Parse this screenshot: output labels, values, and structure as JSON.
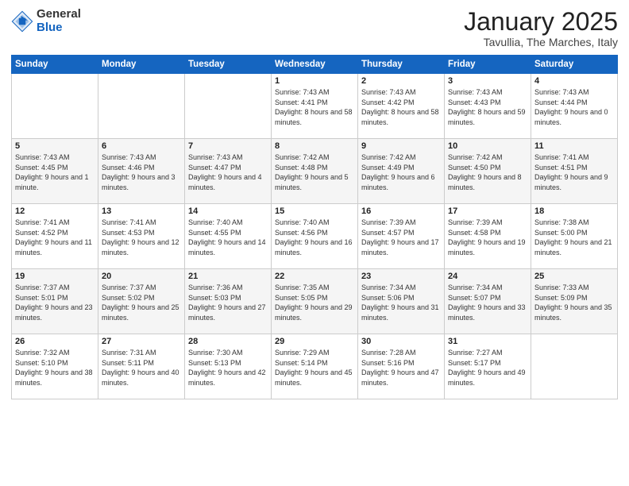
{
  "logo": {
    "general": "General",
    "blue": "Blue"
  },
  "header": {
    "title": "January 2025",
    "subtitle": "Tavullia, The Marches, Italy"
  },
  "weekdays": [
    "Sunday",
    "Monday",
    "Tuesday",
    "Wednesday",
    "Thursday",
    "Friday",
    "Saturday"
  ],
  "weeks": [
    [
      {
        "day": "",
        "info": ""
      },
      {
        "day": "",
        "info": ""
      },
      {
        "day": "",
        "info": ""
      },
      {
        "day": "1",
        "info": "Sunrise: 7:43 AM\nSunset: 4:41 PM\nDaylight: 8 hours\nand 58 minutes."
      },
      {
        "day": "2",
        "info": "Sunrise: 7:43 AM\nSunset: 4:42 PM\nDaylight: 8 hours\nand 58 minutes."
      },
      {
        "day": "3",
        "info": "Sunrise: 7:43 AM\nSunset: 4:43 PM\nDaylight: 8 hours\nand 59 minutes."
      },
      {
        "day": "4",
        "info": "Sunrise: 7:43 AM\nSunset: 4:44 PM\nDaylight: 9 hours\nand 0 minutes."
      }
    ],
    [
      {
        "day": "5",
        "info": "Sunrise: 7:43 AM\nSunset: 4:45 PM\nDaylight: 9 hours\nand 1 minute."
      },
      {
        "day": "6",
        "info": "Sunrise: 7:43 AM\nSunset: 4:46 PM\nDaylight: 9 hours\nand 3 minutes."
      },
      {
        "day": "7",
        "info": "Sunrise: 7:43 AM\nSunset: 4:47 PM\nDaylight: 9 hours\nand 4 minutes."
      },
      {
        "day": "8",
        "info": "Sunrise: 7:42 AM\nSunset: 4:48 PM\nDaylight: 9 hours\nand 5 minutes."
      },
      {
        "day": "9",
        "info": "Sunrise: 7:42 AM\nSunset: 4:49 PM\nDaylight: 9 hours\nand 6 minutes."
      },
      {
        "day": "10",
        "info": "Sunrise: 7:42 AM\nSunset: 4:50 PM\nDaylight: 9 hours\nand 8 minutes."
      },
      {
        "day": "11",
        "info": "Sunrise: 7:41 AM\nSunset: 4:51 PM\nDaylight: 9 hours\nand 9 minutes."
      }
    ],
    [
      {
        "day": "12",
        "info": "Sunrise: 7:41 AM\nSunset: 4:52 PM\nDaylight: 9 hours\nand 11 minutes."
      },
      {
        "day": "13",
        "info": "Sunrise: 7:41 AM\nSunset: 4:53 PM\nDaylight: 9 hours\nand 12 minutes."
      },
      {
        "day": "14",
        "info": "Sunrise: 7:40 AM\nSunset: 4:55 PM\nDaylight: 9 hours\nand 14 minutes."
      },
      {
        "day": "15",
        "info": "Sunrise: 7:40 AM\nSunset: 4:56 PM\nDaylight: 9 hours\nand 16 minutes."
      },
      {
        "day": "16",
        "info": "Sunrise: 7:39 AM\nSunset: 4:57 PM\nDaylight: 9 hours\nand 17 minutes."
      },
      {
        "day": "17",
        "info": "Sunrise: 7:39 AM\nSunset: 4:58 PM\nDaylight: 9 hours\nand 19 minutes."
      },
      {
        "day": "18",
        "info": "Sunrise: 7:38 AM\nSunset: 5:00 PM\nDaylight: 9 hours\nand 21 minutes."
      }
    ],
    [
      {
        "day": "19",
        "info": "Sunrise: 7:37 AM\nSunset: 5:01 PM\nDaylight: 9 hours\nand 23 minutes."
      },
      {
        "day": "20",
        "info": "Sunrise: 7:37 AM\nSunset: 5:02 PM\nDaylight: 9 hours\nand 25 minutes."
      },
      {
        "day": "21",
        "info": "Sunrise: 7:36 AM\nSunset: 5:03 PM\nDaylight: 9 hours\nand 27 minutes."
      },
      {
        "day": "22",
        "info": "Sunrise: 7:35 AM\nSunset: 5:05 PM\nDaylight: 9 hours\nand 29 minutes."
      },
      {
        "day": "23",
        "info": "Sunrise: 7:34 AM\nSunset: 5:06 PM\nDaylight: 9 hours\nand 31 minutes."
      },
      {
        "day": "24",
        "info": "Sunrise: 7:34 AM\nSunset: 5:07 PM\nDaylight: 9 hours\nand 33 minutes."
      },
      {
        "day": "25",
        "info": "Sunrise: 7:33 AM\nSunset: 5:09 PM\nDaylight: 9 hours\nand 35 minutes."
      }
    ],
    [
      {
        "day": "26",
        "info": "Sunrise: 7:32 AM\nSunset: 5:10 PM\nDaylight: 9 hours\nand 38 minutes."
      },
      {
        "day": "27",
        "info": "Sunrise: 7:31 AM\nSunset: 5:11 PM\nDaylight: 9 hours\nand 40 minutes."
      },
      {
        "day": "28",
        "info": "Sunrise: 7:30 AM\nSunset: 5:13 PM\nDaylight: 9 hours\nand 42 minutes."
      },
      {
        "day": "29",
        "info": "Sunrise: 7:29 AM\nSunset: 5:14 PM\nDaylight: 9 hours\nand 45 minutes."
      },
      {
        "day": "30",
        "info": "Sunrise: 7:28 AM\nSunset: 5:16 PM\nDaylight: 9 hours\nand 47 minutes."
      },
      {
        "day": "31",
        "info": "Sunrise: 7:27 AM\nSunset: 5:17 PM\nDaylight: 9 hours\nand 49 minutes."
      },
      {
        "day": "",
        "info": ""
      }
    ]
  ]
}
